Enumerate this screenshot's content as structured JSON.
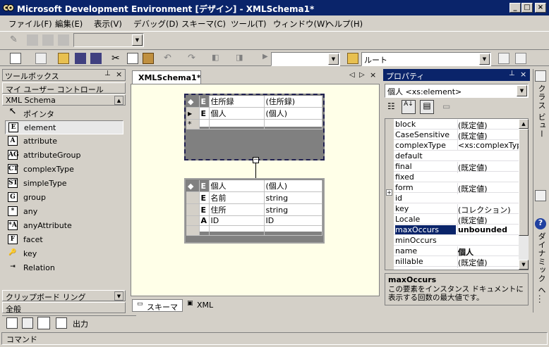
{
  "window": {
    "title": "Microsoft Development Environment [デザイン] - XMLSchema1*",
    "min": "_",
    "max": "□",
    "close": "×"
  },
  "menu": [
    "ファイル(F)",
    "編集(E)",
    "表示(V)",
    "デバッグ(D)",
    "スキーマ(C)",
    "ツール(T)",
    "ウィンドウ(W)",
    "ヘルプ(H)"
  ],
  "toolbar": {
    "address_combo": "ルート",
    "search_combo": ""
  },
  "toolbox": {
    "title": "ツールボックス",
    "pin": "ᵖ",
    "close": "×",
    "tab_user": "マイ ユーザー コントロール",
    "tab_xml": "XML Schema",
    "items": [
      {
        "icon": "↖",
        "label": "ポインタ"
      },
      {
        "icon": "E",
        "label": "element"
      },
      {
        "icon": "A",
        "label": "attribute"
      },
      {
        "icon": "AG",
        "label": "attributeGroup"
      },
      {
        "icon": "CT",
        "label": "complexType"
      },
      {
        "icon": "ST",
        "label": "simpleType"
      },
      {
        "icon": "G",
        "label": "group"
      },
      {
        "icon": "*",
        "label": "any"
      },
      {
        "icon": "*A",
        "label": "anyAttribute"
      },
      {
        "icon": "F",
        "label": "facet"
      },
      {
        "icon": "🔑",
        "label": "key"
      },
      {
        "icon": "⇥",
        "label": "Relation"
      }
    ],
    "clipboard": "クリップボード リング",
    "general": "全般"
  },
  "editor": {
    "tab": "XMLSchema1*",
    "prev": "◁",
    "next": "▷",
    "close": "×",
    "table1": {
      "header": [
        "E",
        "住所録",
        "(住所録)"
      ],
      "rows": [
        [
          "E",
          "個人",
          "(個人)"
        ],
        [
          "*",
          "",
          ""
        ]
      ]
    },
    "table2": {
      "header": [
        "E",
        "個人",
        "(個人)"
      ],
      "rows": [
        [
          "E",
          "名前",
          "string"
        ],
        [
          "E",
          "住所",
          "string"
        ],
        [
          "A",
          "ID",
          "ID"
        ]
      ]
    },
    "bottom_tabs": [
      "スキーマ",
      "XML"
    ]
  },
  "properties": {
    "title": "プロパティ",
    "pin": "ᵖ",
    "close": "×",
    "object": "個人  <xs:element>",
    "rows": [
      {
        "name": "block",
        "value": "(既定値)"
      },
      {
        "name": "CaseSensitive",
        "value": "(既定値)"
      },
      {
        "name": "complexType",
        "value": "<xs:complexType"
      },
      {
        "name": "default",
        "value": ""
      },
      {
        "name": "final",
        "value": "(既定値)"
      },
      {
        "name": "fixed",
        "value": ""
      },
      {
        "name": "form",
        "value": "(既定値)"
      },
      {
        "name": "id",
        "value": ""
      },
      {
        "name": "key",
        "value": "(コレクション)"
      },
      {
        "name": "Locale",
        "value": "(既定値)"
      },
      {
        "name": "maxOccurs",
        "value": "unbounded"
      },
      {
        "name": "minOccurs",
        "value": ""
      },
      {
        "name": "name",
        "value": "個人"
      },
      {
        "name": "nillable",
        "value": "(既定値)"
      }
    ],
    "desc_title": "maxOccurs",
    "desc_text": "この要素をインスタンス ドキュメントに表示する回数の最大値です。"
  },
  "right_strip": {
    "class_view": "クラス ビュー",
    "dynamic_help": "ダイナミック ヘ..."
  },
  "output": {
    "label": "出力",
    "status": "コマンド"
  }
}
